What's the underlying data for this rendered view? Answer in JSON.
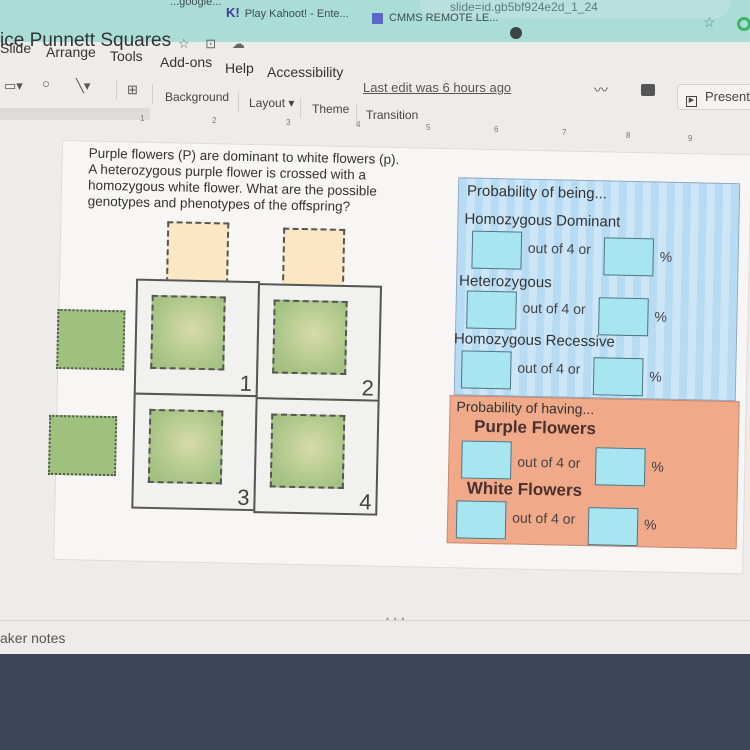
{
  "browser": {
    "url_fragment": "slide=id.gb5bf924e2d_1_24",
    "bookmarks": [
      {
        "label": "...google...",
        "icon": "google-icon"
      },
      {
        "label": "Play Kahoot! - Ente...",
        "icon_text": "K!"
      },
      {
        "label": "CMMS REMOTE LE...",
        "icon": "forms-icon"
      }
    ]
  },
  "app": {
    "doc_title": "ice Punnett Squares",
    "menu": [
      "Slide",
      "Arrange",
      "Tools",
      "Add-ons",
      "Help",
      "Accessibility"
    ],
    "last_edit": "Last edit was 6 hours ago",
    "present_label": "Present",
    "toolbar": {
      "background": "Background",
      "layout": "Layout",
      "theme": "Theme",
      "transition": "Transition"
    },
    "ruler_marks": [
      "1",
      "2",
      "3",
      "4",
      "5",
      "6",
      "7",
      "8",
      "9"
    ],
    "speaker_notes": "aker notes"
  },
  "slide": {
    "question_lines": [
      "Purple flowers (P) are dominant to white flowers (p).",
      "A heterozygous purple flower is crossed with a",
      "homozygous white flower. What are the possible",
      "genotypes and phenotypes of the offspring?"
    ],
    "cells": [
      "1",
      "2",
      "3",
      "4"
    ],
    "being": {
      "title": "Probability of being...",
      "rows": [
        {
          "label": "Homozygous Dominant",
          "out_of": "out of 4 or",
          "pct": "%"
        },
        {
          "label": "Heterozygous",
          "out_of": "out of 4 or",
          "pct": "%"
        },
        {
          "label": "Homozygous Recessive",
          "out_of": "out of 4 or",
          "pct": "%"
        }
      ]
    },
    "having": {
      "title": "Probability of having...",
      "rows": [
        {
          "label": "Purple Flowers",
          "out_of": "out of 4 or",
          "pct": "%"
        },
        {
          "label": "White Flowers",
          "out_of": "out of 4 or",
          "pct": "%"
        }
      ]
    },
    "colors": {
      "parent_top": "#fbe7c3",
      "parent_left": "#9fc17e",
      "panel_blue": "#b8dbf4",
      "panel_orange": "#f0a989",
      "answer_box": "#a7e6f0"
    }
  }
}
